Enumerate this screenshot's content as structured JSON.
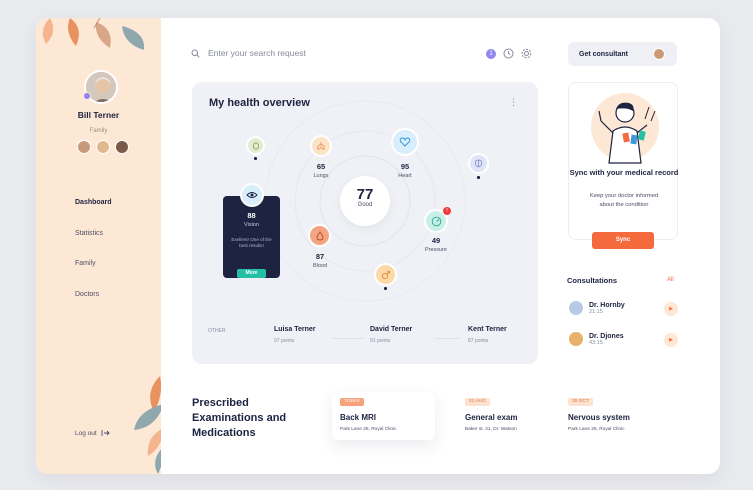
{
  "user": {
    "name": "Bill Terner",
    "role": "Family"
  },
  "nav": {
    "items": [
      "Dashboard",
      "Statistics",
      "Family",
      "Doctors"
    ],
    "logout": "Log out",
    "active": "Dashboard"
  },
  "search": {
    "placeholder": "Enter your search request"
  },
  "header": {
    "notification_count": "1",
    "consult_button": "Get consultant"
  },
  "overview": {
    "title": "My health overview",
    "center": {
      "value": "77",
      "label": "Good"
    },
    "metrics": {
      "lungs": {
        "value": "65",
        "name": "Lungs"
      },
      "heart": {
        "value": "95",
        "name": "Heart"
      },
      "vision": {
        "value": "88",
        "name": "Vision"
      },
      "pressure": {
        "value": "49",
        "name": "Pressure",
        "alert": "!"
      },
      "blood": {
        "value": "87",
        "name": "Blood"
      }
    },
    "vision_card": {
      "description": "Exellent! One of the best results!",
      "button": "More"
    },
    "other_label": "OTHER",
    "members": [
      {
        "name": "Luisa Terner",
        "points": "97 points"
      },
      {
        "name": "David Terner",
        "points": "91 points"
      },
      {
        "name": "Kent Terner",
        "points": "87 points"
      }
    ]
  },
  "sync": {
    "title": "Sync with your medical record",
    "description": "Keep your doctor informed about the condition",
    "button": "Sync"
  },
  "consultations": {
    "title": "Consultations",
    "all": "All",
    "doctors": [
      {
        "name": "Dr. Hornby",
        "time": "21:15"
      },
      {
        "name": "Dr. Djones",
        "time": "43:15"
      }
    ]
  },
  "prescribed": {
    "title": "Prescribed Examinations and Medications",
    "exams": [
      {
        "tag": "TODAY",
        "title": "Back MRI",
        "address": "Park Lane 25, Royal Clinic"
      },
      {
        "tag": "21 AUG",
        "title": "General exam",
        "address": "Baker st. 21, Dr. Watson"
      },
      {
        "tag": "25 OCT",
        "title": "Nervous system",
        "address": "Park Lane 25, Royal Clinic"
      }
    ]
  },
  "colors": {
    "accent": "#f46a3c",
    "navy": "#1d2340",
    "teal": "#23c0a6",
    "sidebar": "#fde8d6",
    "purple": "#8f86f2"
  }
}
